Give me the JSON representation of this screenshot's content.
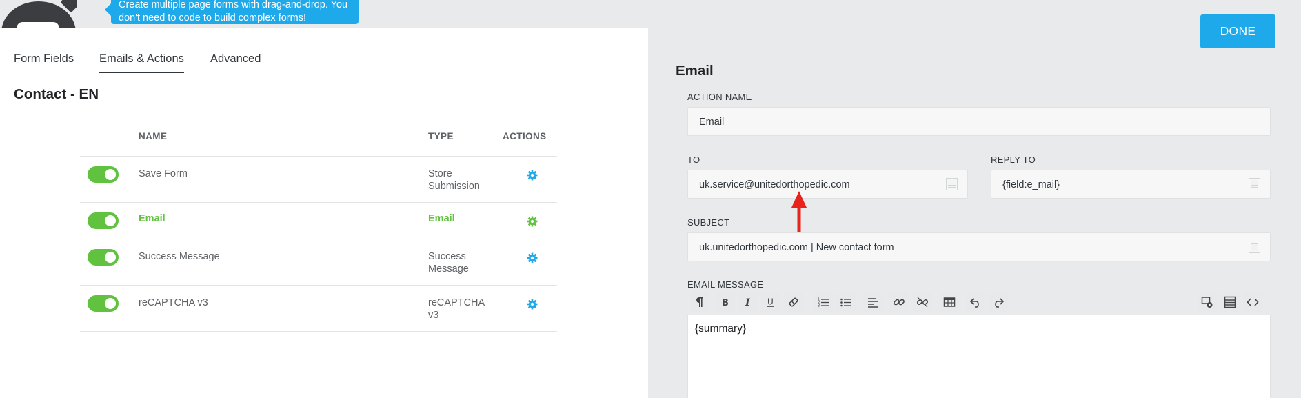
{
  "tooltip": {
    "line1": "Create multiple page forms with drag-and-drop. You",
    "line2": "don't need to code to build complex forms!"
  },
  "tabs": [
    {
      "label": "Form Fields",
      "active": false
    },
    {
      "label": "Emails & Actions",
      "active": true
    },
    {
      "label": "Advanced",
      "active": false
    }
  ],
  "form_title": "Contact - EN",
  "table": {
    "headers": {
      "name": "NAME",
      "type": "TYPE",
      "actions": "ACTIONS"
    },
    "rows": [
      {
        "name": "Save Form",
        "type": "Store Submission",
        "enabled": true,
        "active": false
      },
      {
        "name": "Email",
        "type": "Email",
        "enabled": true,
        "active": true
      },
      {
        "name": "Success Message",
        "type": "Success Message",
        "enabled": true,
        "active": false
      },
      {
        "name": "reCAPTCHA v3",
        "type": "reCAPTCHA v3",
        "enabled": true,
        "active": false
      }
    ]
  },
  "drawer": {
    "done_label": "DONE",
    "title": "Email",
    "action_name": {
      "label": "ACTION NAME",
      "value": "Email"
    },
    "to": {
      "label": "TO",
      "value": "uk.service@unitedorthopedic.com"
    },
    "reply_to": {
      "label": "REPLY TO",
      "value": "{field:e_mail}"
    },
    "subject": {
      "label": "SUBJECT",
      "value": "uk.unitedorthopedic.com | New contact form"
    },
    "email_message": {
      "label": "EMAIL MESSAGE",
      "value": "{summary}"
    }
  },
  "toolbar_icons": [
    "paragraph-icon",
    "bold-icon",
    "italic-icon",
    "underline-icon",
    "eraser-icon",
    "ordered-list-icon",
    "unordered-list-icon",
    "align-left-icon",
    "link-icon",
    "unlink-icon",
    "table-icon",
    "undo-icon",
    "redo-icon",
    "media-icon",
    "merge-tags-icon",
    "code-icon"
  ],
  "colors": {
    "accent_blue": "#1ea9ea",
    "toggle_green": "#60c23f",
    "annotation_red": "#e8231c"
  }
}
